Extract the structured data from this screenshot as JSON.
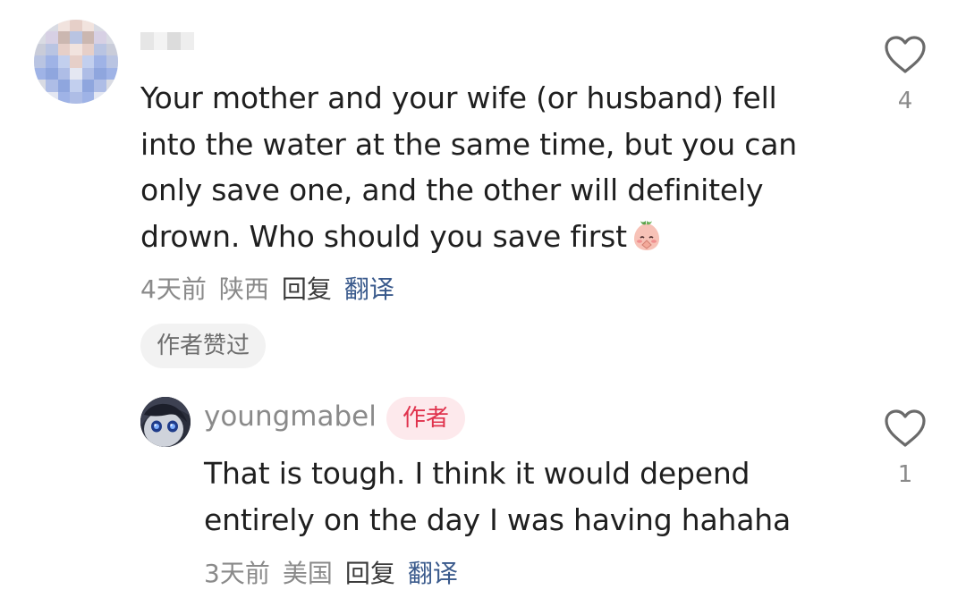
{
  "comment": {
    "author_avatar_icon": "blurred-avatar-icon",
    "author_name_icon": "blurred-name-icon",
    "text": "Your mother and your wife (or husband) fell\ninto the water at the same time, but you can\nonly save one, and the other will definitely\ndrown. Who should you save first",
    "emoji_icon": "peach-praying-emoji-icon",
    "time": "4天前",
    "location": "陕西",
    "reply_label": "回复",
    "translate_label": "翻译",
    "author_liked_label": "作者赞过",
    "like_count": "4",
    "like_icon": "heart-outline-icon"
  },
  "reply": {
    "avatar_icon": "anime-avatar-icon",
    "username": "youngmabel",
    "author_badge": "作者",
    "text": "That is tough. I think it would depend\nentirely on the day I was having hahaha",
    "time": "3天前",
    "location": "美国",
    "reply_label": "回复",
    "translate_label": "翻译",
    "like_count": "1",
    "like_icon": "heart-outline-icon"
  },
  "colors": {
    "text_primary": "#1f1f1f",
    "text_secondary": "#8a8a8a",
    "translate_link": "#3a5a8c",
    "author_badge_bg": "#fde9ec",
    "author_badge_text": "#e0334d",
    "pill_bg": "#f2f2f2"
  }
}
